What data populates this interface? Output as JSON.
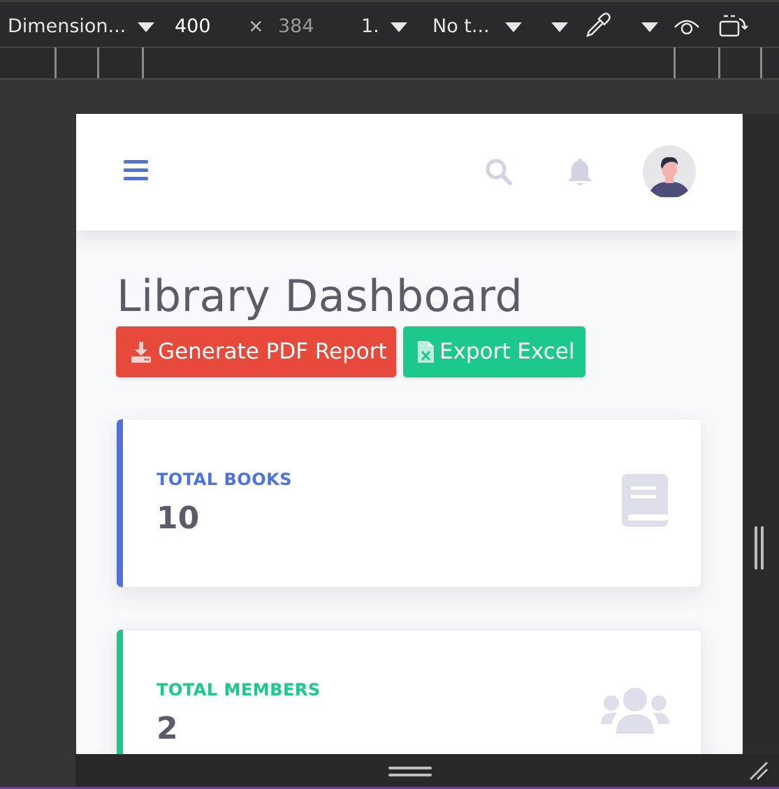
{
  "devtools": {
    "device_label": "Dimension...",
    "width_value": "400",
    "times_symbol": "×",
    "height_value": "384",
    "dpr_label": "1.",
    "throttle_label": "No t..."
  },
  "navbar": {
    "menu_icon": "hamburger-icon",
    "search_icon": "search-icon",
    "bell_icon": "bell-icon",
    "avatar_icon": "user-avatar"
  },
  "page": {
    "title": "Library Dashboard"
  },
  "actions": {
    "pdf_label": "Generate PDF Report",
    "pdf_icon": "download-icon",
    "excel_label": "Export Excel",
    "excel_icon": "file-excel-icon"
  },
  "cards": [
    {
      "label": "TOTAL BOOKS",
      "value": "10",
      "icon": "book-icon",
      "color": "#4e73df"
    },
    {
      "label": "TOTAL MEMBERS",
      "value": "2",
      "icon": "users-icon",
      "color": "#1cc88a"
    }
  ],
  "colors": {
    "primary": "#4e73df",
    "danger": "#e74a3b",
    "success": "#1cc88a",
    "text": "#5a5c69",
    "icon_muted": "#dddfeb"
  }
}
